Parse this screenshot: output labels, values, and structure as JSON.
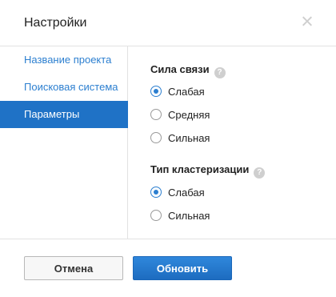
{
  "dialog": {
    "title": "Настройки"
  },
  "sidebar": {
    "items": [
      {
        "label": "Название проекта"
      },
      {
        "label": "Поисковая система"
      },
      {
        "label": "Параметры"
      }
    ]
  },
  "settings": {
    "strength": {
      "label": "Сила связи",
      "options": [
        "Слабая",
        "Средняя",
        "Сильная"
      ],
      "selected": "Слабая"
    },
    "clustering": {
      "label": "Тип кластеризации",
      "options": [
        "Слабая",
        "Сильная"
      ],
      "selected": "Слабая"
    }
  },
  "footer": {
    "cancel_label": "Отмена",
    "update_label": "Обновить"
  },
  "colors": {
    "accent": "#1f72c6",
    "link": "#2c7fd0"
  },
  "icons": {
    "close": "close-icon",
    "help": "help-icon"
  }
}
